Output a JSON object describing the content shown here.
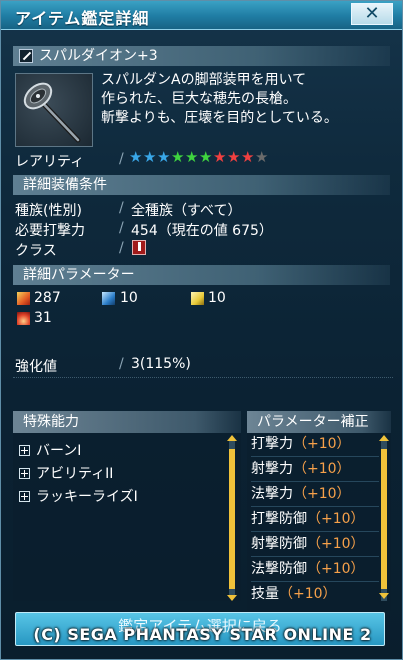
{
  "window": {
    "title": "アイテム鑑定詳細",
    "close_glyph": "✕"
  },
  "item": {
    "name": "スパルダイオン+3",
    "description": [
      "スパルダンAの脚部装甲を用いて",
      "作られた、巨大な穂先の長槍。",
      "斬撃よりも、圧壊を目的としている。"
    ],
    "icon": "spear-weapon-icon"
  },
  "rarity": {
    "label": "レアリティ",
    "stars": [
      {
        "color": "#39a7e8"
      },
      {
        "color": "#39a7e8"
      },
      {
        "color": "#39a7e8"
      },
      {
        "color": "#3fd43f"
      },
      {
        "color": "#3fd43f"
      },
      {
        "color": "#3fd43f"
      },
      {
        "color": "#f04040"
      },
      {
        "color": "#f04040"
      },
      {
        "color": "#f04040"
      },
      {
        "color": "#6b6b6b"
      }
    ]
  },
  "requirements": {
    "header": "詳細装備条件",
    "race_label": "種族(性別)",
    "race_value": "全種族（すべて）",
    "attack_label": "必要打撃力",
    "attack_value": "454（現在の値 675）",
    "class_label": "クラス",
    "class_icon": "hunter-class-icon"
  },
  "parameters": {
    "header": "詳細パラメーター",
    "atk_value": "287",
    "ratk_value": "10",
    "tatk_value": "10",
    "element_value": "31",
    "grind_label": "強化値",
    "grind_value": "3(115%)"
  },
  "special": {
    "header": "特殊能力",
    "items": [
      "バーンI",
      "アビリティII",
      "ラッキーライズI"
    ]
  },
  "bonus": {
    "header": "パラメーター補正",
    "rows": [
      {
        "label": "打撃力",
        "value": "（+10）"
      },
      {
        "label": "射撃力",
        "value": "（+10）"
      },
      {
        "label": "法撃力",
        "value": "（+10）"
      },
      {
        "label": "打撃防御",
        "value": "（+10）"
      },
      {
        "label": "射撃防御",
        "value": "（+10）"
      },
      {
        "label": "法撃防御",
        "value": "（+10）"
      },
      {
        "label": "技量",
        "value": "（+10）"
      }
    ]
  },
  "footer": {
    "button_label": "鑑定アイテム選択に戻る",
    "copyright": "(C) SEGA   PHANTASY STAR ONLINE 2"
  },
  "colors": {
    "accent": "#2f9fc9",
    "bonus": "#f7a14a",
    "scroll": "#f0c23a"
  }
}
